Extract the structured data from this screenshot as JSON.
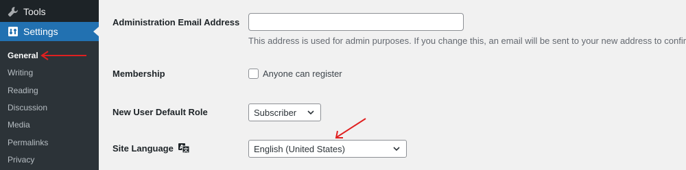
{
  "sidebar": {
    "tools_label": "Tools",
    "settings_label": "Settings",
    "items": [
      {
        "label": "General",
        "current": true
      },
      {
        "label": "Writing"
      },
      {
        "label": "Reading"
      },
      {
        "label": "Discussion"
      },
      {
        "label": "Media"
      },
      {
        "label": "Permalinks"
      },
      {
        "label": "Privacy"
      }
    ]
  },
  "form": {
    "admin_email": {
      "label": "Administration Email Address",
      "value": "",
      "description": "This address is used for admin purposes. If you change this, an email will be sent to your new address to confirm it."
    },
    "membership": {
      "label": "Membership",
      "checkbox_label": "Anyone can register",
      "checked": false
    },
    "default_role": {
      "label": "New User Default Role",
      "selected": "Subscriber"
    },
    "site_language": {
      "label": "Site Language",
      "selected": "English (United States)"
    }
  },
  "annotations": {
    "arrow_color": "#e02020"
  },
  "colors": {
    "sidebar_bg": "#1d2327",
    "submenu_bg": "#2c3338",
    "active_bg": "#2271b1",
    "page_bg": "#f1f1f1"
  },
  "icons": [
    "wrench-icon",
    "settings-icon",
    "translate-icon",
    "chevron-down-icon"
  ]
}
